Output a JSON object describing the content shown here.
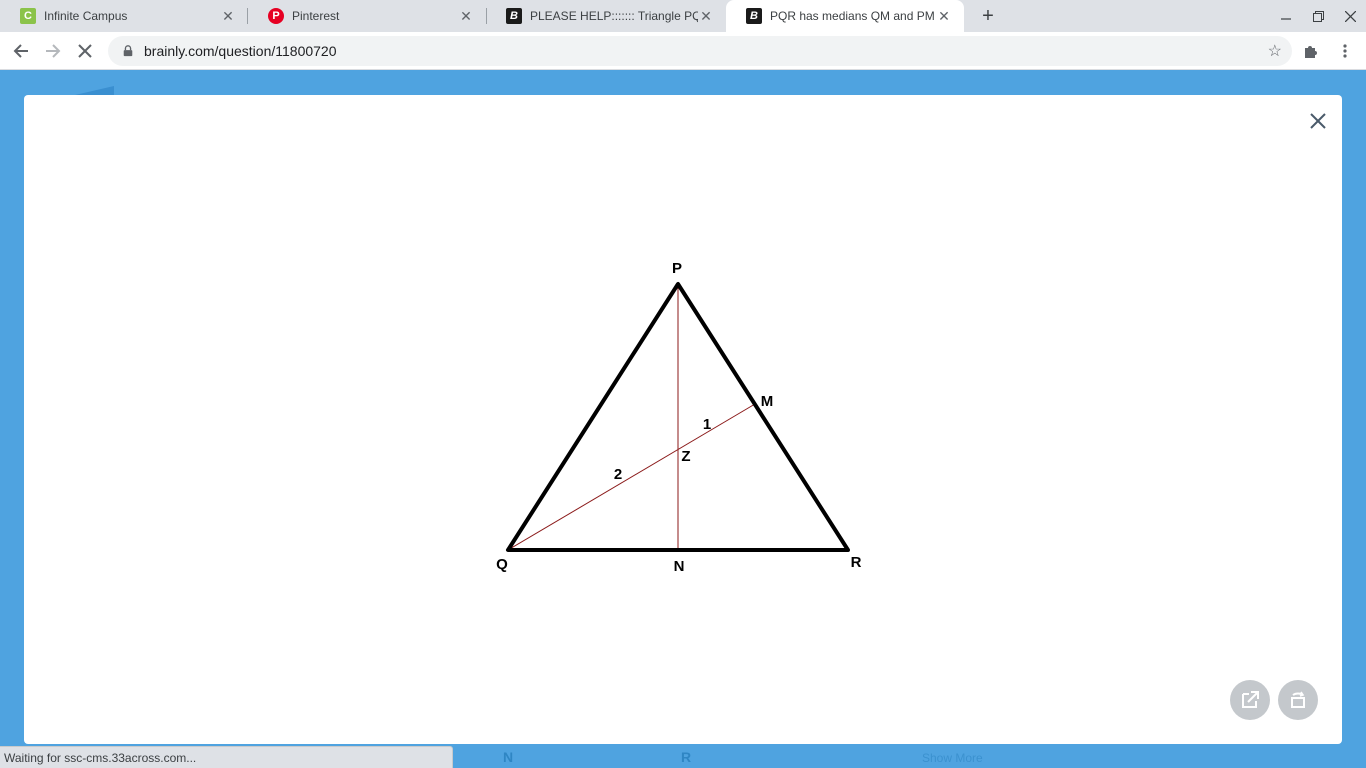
{
  "tabs": [
    {
      "title": "Infinite Campus",
      "favicon": "campus-c-icon",
      "favicon_text": "C"
    },
    {
      "title": "Pinterest",
      "favicon": "pinterest-icon",
      "favicon_text": "P"
    },
    {
      "title": "PLEASE HELP::::::: Triangle PQR h",
      "favicon": "brainly-b-icon",
      "favicon_text": "B"
    },
    {
      "title": "PQR has medians QM and PM th",
      "favicon": "brainly-b-icon",
      "favicon_text": "B"
    }
  ],
  "address_bar": {
    "url": "brainly.com/question/11800720"
  },
  "figure": {
    "labels": {
      "P": "P",
      "Q": "Q",
      "R": "R",
      "M": "M",
      "N": "N",
      "Z": "Z",
      "seg_1": "1",
      "seg_2": "2"
    },
    "colors": {
      "triangle": "#000000",
      "medians": "#8b1a1a"
    }
  },
  "behind": {
    "n": "N",
    "r": "R",
    "show_more": "Show More"
  },
  "status_bar": {
    "text": "Waiting for ssc-cms.33across.com..."
  },
  "colors": {
    "page_bg": "#4fa3e0",
    "tabstrip": "#dee1e6",
    "fab": "#c4c8cc"
  }
}
